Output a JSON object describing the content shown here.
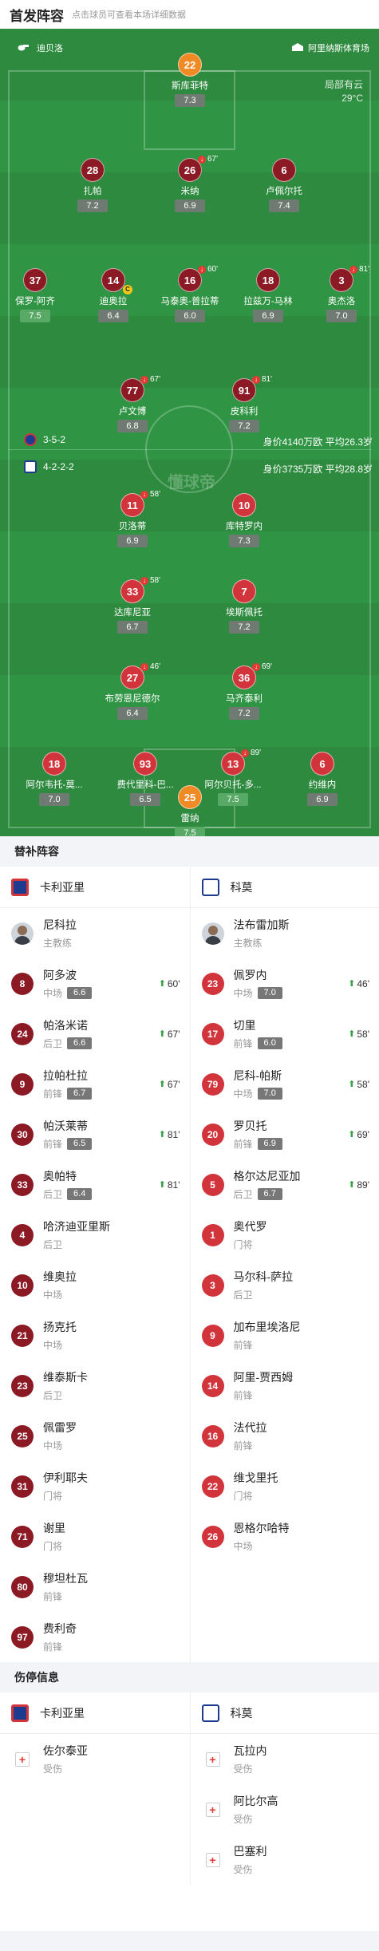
{
  "header": {
    "title": "首发阵容",
    "hint": "点击球员可查看本场详细数据"
  },
  "pitch": {
    "home_team": "迪贝洛",
    "away_team": "阿里纳斯体育场",
    "weather": "局部有云",
    "temperature": "29°C",
    "watermark": "懂球帝",
    "home_formation": "3-5-2",
    "home_value": "身价4140万欧 平均26.3岁",
    "away_formation": "4-2-2-2",
    "away_value": "身价3735万欧 平均28.8岁"
  },
  "players": [
    {
      "num": "22",
      "name": "斯库菲特",
      "rating": "7.3",
      "color": "orange"
    },
    {
      "num": "28",
      "name": "扎帕",
      "rating": "7.2",
      "color": "dred"
    },
    {
      "num": "26",
      "name": "米纳",
      "rating": "6.9",
      "color": "dred",
      "side": "67'"
    },
    {
      "num": "6",
      "name": "卢佩尔托",
      "rating": "7.4",
      "color": "dred"
    },
    {
      "num": "37",
      "name": "保罗-阿齐",
      "rating": "7.5",
      "color": "dred"
    },
    {
      "num": "14",
      "name": "迪奥拉",
      "rating": "6.4",
      "color": "dred",
      "cap": "C"
    },
    {
      "num": "16",
      "name": "马泰奥-普拉蒂",
      "rating": "6.0",
      "color": "dred",
      "side": "60'"
    },
    {
      "num": "18",
      "name": "拉兹万-马林",
      "rating": "6.9",
      "color": "dred"
    },
    {
      "num": "3",
      "name": "奥杰洛",
      "rating": "7.0",
      "color": "dred",
      "side": "81'"
    },
    {
      "num": "77",
      "name": "卢文博",
      "rating": "6.8",
      "color": "dred",
      "side": "67'"
    },
    {
      "num": "91",
      "name": "皮科利",
      "rating": "7.2",
      "color": "dred",
      "side": "81'"
    },
    {
      "num": "11",
      "name": "贝洛蒂",
      "rating": "6.9",
      "color": "red",
      "side": "58'"
    },
    {
      "num": "10",
      "name": "库特罗内",
      "rating": "7.3",
      "color": "red"
    },
    {
      "num": "33",
      "name": "达库尼亚",
      "rating": "6.7",
      "color": "red",
      "side": "58'"
    },
    {
      "num": "7",
      "name": "埃斯佩托",
      "rating": "7.2",
      "color": "red"
    },
    {
      "num": "27",
      "name": "布劳恩尼德尔",
      "rating": "6.4",
      "color": "red",
      "side": "46'"
    },
    {
      "num": "36",
      "name": "马齐泰利",
      "rating": "7.2",
      "color": "red",
      "side": "69'"
    },
    {
      "num": "18",
      "name": "阿尔韦托-莫...",
      "rating": "7.0",
      "color": "red"
    },
    {
      "num": "93",
      "name": "费代里科-巴...",
      "rating": "6.5",
      "color": "red"
    },
    {
      "num": "13",
      "name": "阿尔贝托-多...",
      "rating": "7.5",
      "color": "red",
      "side": "89'"
    },
    {
      "num": "6",
      "name": "约维内",
      "rating": "6.9",
      "color": "red"
    },
    {
      "num": "25",
      "name": "雷纳",
      "rating": "7.5",
      "color": "orange"
    }
  ],
  "subs_title": "替补阵容",
  "home_name": "卡利亚里",
  "away_name": "科莫",
  "home_coach": {
    "name": "尼科拉",
    "role": "主教练"
  },
  "away_coach": {
    "name": "法布雷加斯",
    "role": "主教练"
  },
  "home_subs": [
    {
      "num": "8",
      "name": "阿多波",
      "pos": "中场",
      "rating": "6.6",
      "time": "60'"
    },
    {
      "num": "24",
      "name": "帕洛米诺",
      "pos": "后卫",
      "rating": "6.6",
      "time": "67'"
    },
    {
      "num": "9",
      "name": "拉帕杜拉",
      "pos": "前锋",
      "rating": "6.7",
      "time": "67'"
    },
    {
      "num": "30",
      "name": "帕沃莱蒂",
      "pos": "前锋",
      "rating": "6.5",
      "time": "81'"
    },
    {
      "num": "33",
      "name": "奥帕特",
      "pos": "后卫",
      "rating": "6.4",
      "time": "81'"
    },
    {
      "num": "4",
      "name": "哈济迪亚里斯",
      "pos": "后卫"
    },
    {
      "num": "10",
      "name": "维奥拉",
      "pos": "中场"
    },
    {
      "num": "21",
      "name": "扬克托",
      "pos": "中场"
    },
    {
      "num": "23",
      "name": "维泰斯卡",
      "pos": "后卫"
    },
    {
      "num": "25",
      "name": "佩雷罗",
      "pos": "中场"
    },
    {
      "num": "31",
      "name": "伊利耶夫",
      "pos": "门将"
    },
    {
      "num": "71",
      "name": "谢里",
      "pos": "门将"
    },
    {
      "num": "80",
      "name": "穆坦杜瓦",
      "pos": "前锋"
    },
    {
      "num": "97",
      "name": "费利奇",
      "pos": "前锋"
    }
  ],
  "away_subs": [
    {
      "num": "23",
      "name": "佩罗内",
      "pos": "中场",
      "rating": "7.0",
      "time": "46'"
    },
    {
      "num": "17",
      "name": "切里",
      "pos": "前锋",
      "rating": "6.0",
      "time": "58'"
    },
    {
      "num": "79",
      "name": "尼科-帕斯",
      "pos": "中场",
      "rating": "7.0",
      "time": "58'"
    },
    {
      "num": "20",
      "name": "罗贝托",
      "pos": "前锋",
      "rating": "6.9",
      "time": "69'"
    },
    {
      "num": "5",
      "name": "格尔达尼亚加",
      "pos": "后卫",
      "rating": "6.7",
      "time": "89'"
    },
    {
      "num": "1",
      "name": "奥代罗",
      "pos": "门将"
    },
    {
      "num": "3",
      "name": "马尔科-萨拉",
      "pos": "后卫"
    },
    {
      "num": "9",
      "name": "加布里埃洛尼",
      "pos": "前锋"
    },
    {
      "num": "14",
      "name": "阿里-贾西姆",
      "pos": "前锋"
    },
    {
      "num": "16",
      "name": "法代拉",
      "pos": "前锋"
    },
    {
      "num": "22",
      "name": "维戈里托",
      "pos": "门将"
    },
    {
      "num": "26",
      "name": "恩格尔哈特",
      "pos": "中场"
    }
  ],
  "injury_title": "伤停信息",
  "home_injuries": [
    {
      "name": "佐尔泰亚",
      "status": "受伤"
    }
  ],
  "away_injuries": [
    {
      "name": "瓦拉内",
      "status": "受伤"
    },
    {
      "name": "阿比尔高",
      "status": "受伤"
    },
    {
      "name": "巴塞利",
      "status": "受伤"
    }
  ],
  "colors": {
    "home": "#d2343c",
    "home_dark": "#8c1a25",
    "away": "#1e3c8f",
    "pitch": "#2d8a3e",
    "gk": "#f08a24"
  }
}
